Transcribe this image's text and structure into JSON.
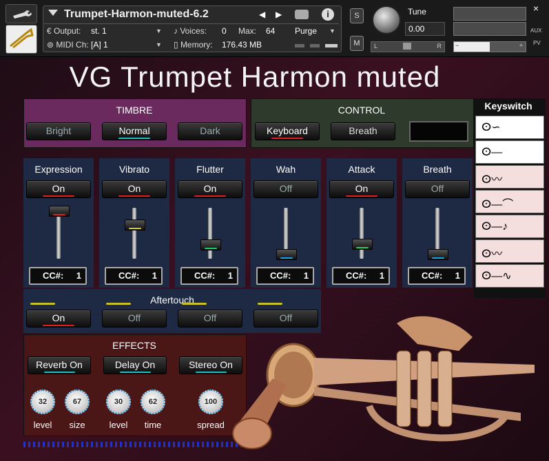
{
  "header": {
    "instrument_name": "Trumpet-Harmon-muted-6.2",
    "output_label": "Output:",
    "output_value": "st. 1",
    "voices_label": "Voices:",
    "voices_value": "0",
    "max_label": "Max:",
    "max_value": "64",
    "purge_label": "Purge",
    "midi_label": "MIDI Ch:",
    "midi_value": "[A]  1",
    "memory_label": "Memory:",
    "memory_value": "176.43 MB",
    "solo_label": "S",
    "mute_label": "M",
    "tune_label": "Tune",
    "tune_value": "0.00",
    "pan_left": "L",
    "pan_right": "R",
    "aux_label": "AUX",
    "pv_label": "PV",
    "close_label": "×",
    "minus_label": "−",
    "plus_label": "+"
  },
  "title": "VG Trumpet Harmon muted",
  "timbre": {
    "title": "TIMBRE",
    "buttons": [
      "Bright",
      "Normal",
      "Dark"
    ]
  },
  "control": {
    "title": "CONTROL",
    "buttons": [
      "Keyboard",
      "Breath"
    ]
  },
  "keyswitch": {
    "title": "Keyswitch"
  },
  "faders": [
    {
      "label": "Expression",
      "state": "On",
      "cc_label": "CC#:",
      "cc_value": "1",
      "level": 0.95,
      "color": "#e02020"
    },
    {
      "label": "Vibrato",
      "state": "On",
      "cc_label": "CC#:",
      "cc_value": "1",
      "level": 0.68,
      "color": "#d8d020"
    },
    {
      "label": "Flutter",
      "state": "On",
      "cc_label": "CC#:",
      "cc_value": "1",
      "level": 0.28,
      "color": "#20d060"
    },
    {
      "label": "Wah",
      "state": "Off",
      "cc_label": "CC#:",
      "cc_value": "1",
      "level": 0.1,
      "color": "#20a0e0"
    },
    {
      "label": "Attack",
      "state": "On",
      "cc_label": "CC#:",
      "cc_value": "1",
      "level": 0.3,
      "color": "#20d060"
    },
    {
      "label": "Breath",
      "state": "Off",
      "cc_label": "CC#:",
      "cc_value": "1",
      "level": 0.1,
      "color": "#20a0e0"
    }
  ],
  "aftertouch": {
    "title": "Aftertouch",
    "buttons": [
      "On",
      "Off",
      "Off",
      "Off"
    ]
  },
  "effects": {
    "title": "EFFECTS",
    "buttons": [
      "Reverb On",
      "Delay On",
      "Stereo On"
    ],
    "knobs": [
      {
        "value": "32",
        "label": "level"
      },
      {
        "value": "67",
        "label": "size"
      },
      {
        "value": "30",
        "label": "level"
      },
      {
        "value": "62",
        "label": "time"
      },
      {
        "value": "100",
        "label": "spread"
      }
    ]
  }
}
